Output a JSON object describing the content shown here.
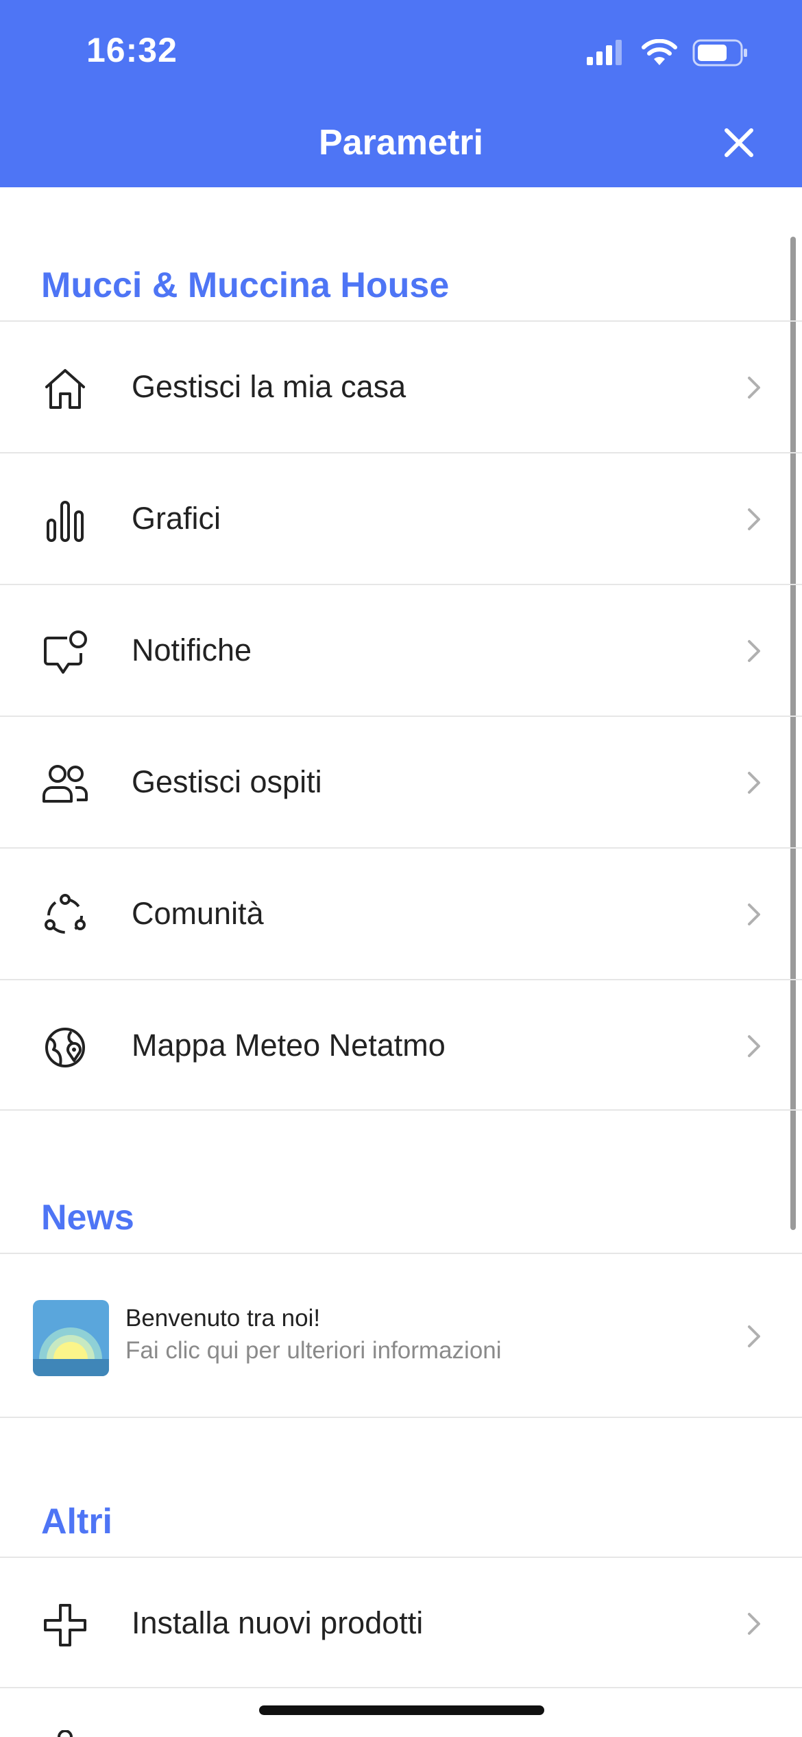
{
  "status_bar": {
    "time": "16:32"
  },
  "header": {
    "title": "Parametri"
  },
  "home_section": {
    "title": "Mucci & Muccina House",
    "items": [
      {
        "label": "Gestisci la mia casa",
        "icon": "house-icon"
      },
      {
        "label": "Grafici",
        "icon": "bar-chart-icon"
      },
      {
        "label": "Notifiche",
        "icon": "notification-bubble-icon"
      },
      {
        "label": "Gestisci ospiti",
        "icon": "guests-icon"
      },
      {
        "label": "Comunità",
        "icon": "community-icon"
      },
      {
        "label": "Mappa Meteo Netatmo",
        "icon": "globe-pin-icon"
      }
    ]
  },
  "news_section": {
    "title": "News",
    "item": {
      "title": "Benvenuto tra noi!",
      "subtitle": "Fai clic qui per ulteriori informazioni"
    }
  },
  "other_section": {
    "title": "Altri",
    "items": [
      {
        "label": "Installa nuovi prodotti",
        "icon": "plus-icon"
      }
    ]
  },
  "colors": {
    "accent": "#4e75f5",
    "divider": "#e6e6e6",
    "chevron": "#b0b0b0"
  }
}
